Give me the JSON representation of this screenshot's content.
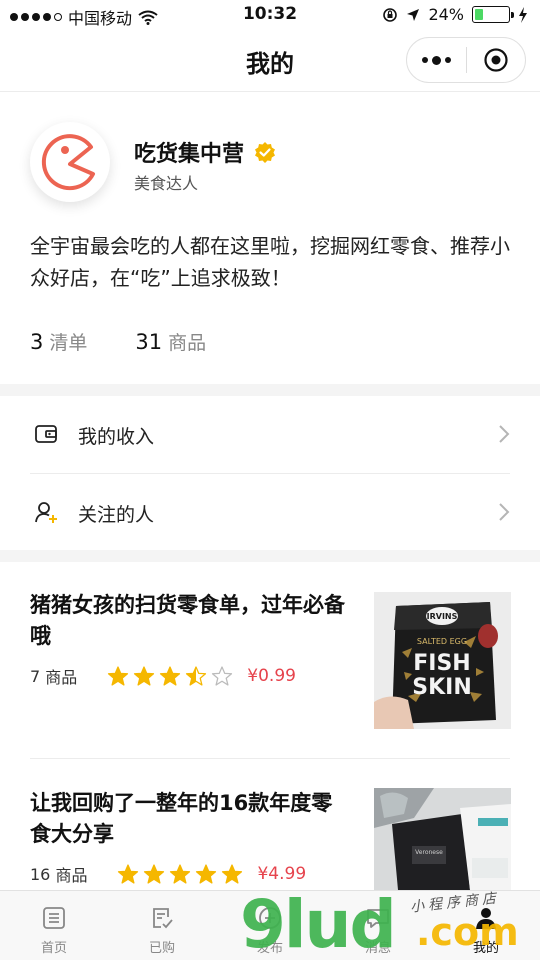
{
  "status_bar": {
    "carrier": "中国移动",
    "time": "10:32",
    "battery_percent": "24%"
  },
  "nav": {
    "title": "我的"
  },
  "profile": {
    "name": "吃货集中营",
    "subtitle": "美食达人",
    "bio": "全宇宙最会吃的人都在这里啦，挖掘网红零食、推荐小众好店，在“吃”上追求极致！",
    "stats": [
      {
        "value": "3",
        "label": "清单"
      },
      {
        "value": "31",
        "label": "商品"
      }
    ]
  },
  "menu": {
    "items": [
      {
        "label": "我的收入",
        "icon": "wallet-icon"
      },
      {
        "label": "关注的人",
        "icon": "follow-user-icon"
      }
    ]
  },
  "lists": [
    {
      "title": "猪猪女孩的扫货零食单，过年必备哦",
      "count": "7",
      "count_label": "商品",
      "rating": 3.5,
      "price": "¥0.99",
      "thumb_text_top": "IRVINS",
      "thumb_text_mid": "SALTED EGG",
      "thumb_text_main1": "FISH",
      "thumb_text_main2": "SKIN"
    },
    {
      "title": "让我回购了一整年的16款年度零食大分享",
      "count": "16",
      "count_label": "商品",
      "rating": 5,
      "price": "¥4.99",
      "thumb_text_top": "Veronese"
    }
  ],
  "tabbar": {
    "tabs": [
      {
        "label": "首页",
        "icon": "home-list-icon",
        "active": false
      },
      {
        "label": "已购",
        "icon": "purchased-icon",
        "active": false
      },
      {
        "label": "发布",
        "icon": "publish-icon",
        "active": false
      },
      {
        "label": "消息",
        "icon": "message-icon",
        "active": false
      },
      {
        "label": "我的",
        "icon": "profile-icon",
        "active": true
      }
    ]
  },
  "watermark": {
    "logo": "9lud",
    "suffix": ".com",
    "caption": "小程序商店"
  },
  "colors": {
    "accent_red": "#e6434c",
    "star": "#f5b700",
    "verified": "#f5b700",
    "avatar_stroke": "#ec6452"
  }
}
